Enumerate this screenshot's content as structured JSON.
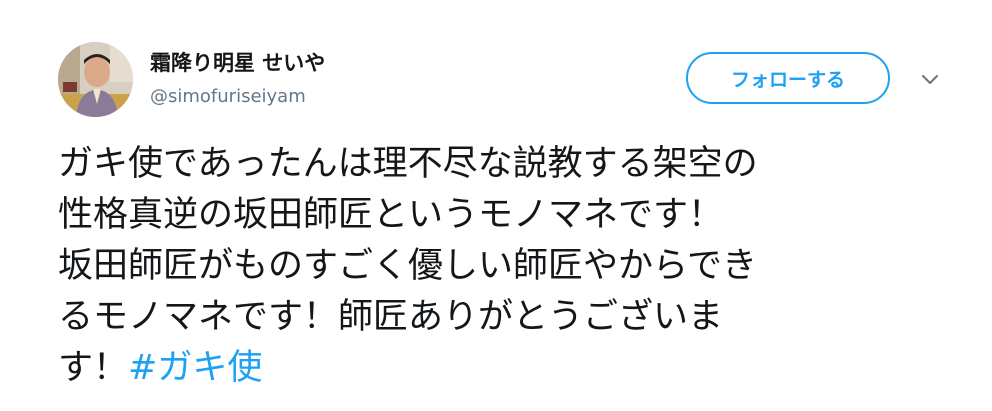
{
  "user": {
    "display_name": "霜降り明星 せいや",
    "screen_name": "@simofuriseiyam"
  },
  "actions": {
    "follow_label": "フォローする"
  },
  "tweet": {
    "text": "ガキ使であったんは理不尽な説教する架空の\n性格真逆の坂田師匠というモノマネです！\n坂田師匠がものすごく優しい師匠やからでき\nるモノマネです！師匠ありがとうございま\nす！",
    "hashtag": "#ガキ使"
  },
  "colors": {
    "accent": "#1da1f2",
    "text": "#14171a",
    "secondary_text": "#657786"
  },
  "icons": {
    "avatar": "profile-photo",
    "menu": "chevron-down-icon"
  }
}
